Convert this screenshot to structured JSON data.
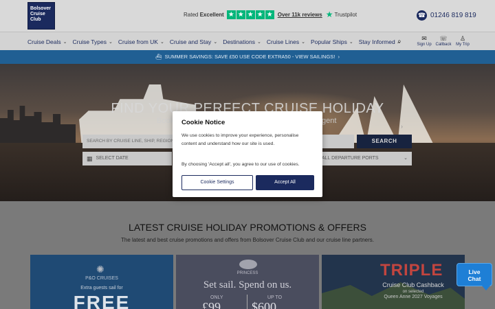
{
  "header": {
    "logo_text": "Bolsover Cruise Club",
    "rating_prefix": "Rated",
    "rating_word": "Excellent",
    "reviews_text": "Over 11k reviews",
    "trustpilot_label": "Trustpilot",
    "phone": "01246 819 819"
  },
  "nav": {
    "items": [
      {
        "label": "Cruise Deals"
      },
      {
        "label": "Cruise Types"
      },
      {
        "label": "Cruise from UK"
      },
      {
        "label": "Cruise and Stay"
      },
      {
        "label": "Destinations"
      },
      {
        "label": "Cruise Lines"
      },
      {
        "label": "Popular Ships"
      },
      {
        "label": "Stay Informed"
      }
    ],
    "icons": [
      {
        "label": "Sign Up",
        "icon": "envelope-icon"
      },
      {
        "label": "Callback",
        "icon": "chat-icon"
      },
      {
        "label": "My Trip",
        "icon": "user-icon"
      }
    ]
  },
  "promo_banner": "SUMMER SAVINGS: SAVE £50 USE CODE EXTRA50 - VIEW SAILINGS!",
  "hero": {
    "title": "FIND YOUR PERFECT CRUISE HOLIDAY",
    "subtitle_left": "Book",
    "subtitle_right": "gent",
    "search_placeholder": "SEARCH BY CRUISE LINE, SHIP, REGION",
    "search_button": "SEARCH",
    "date_placeholder": "SELECT DATE",
    "ports_placeholder": "ALL DEPARTURE PORTS"
  },
  "promotions": {
    "title": "LATEST CRUISE HOLIDAY PROMOTIONS & OFFERS",
    "subtitle": "The latest and best cruise promotions and offers from Bolsover Cruise Club and our cruise line partners.",
    "card1": {
      "brand": "P&O CRUISES",
      "line": "Extra guests sail for",
      "big": "FREE"
    },
    "card2": {
      "brand": "PRINCESS",
      "headline": "Set sail. Spend on us.",
      "only": "ONLY",
      "upto": "UP TO",
      "price1": "£99",
      "price2": "$600"
    },
    "card3": {
      "triple": "TRIPLE",
      "line2": "Cruise Club Cashback",
      "line3": "on selected",
      "line4": "Queen Anne 2027 Voyages"
    }
  },
  "cookie": {
    "title": "Cookie Notice",
    "text": "We use cookies to improve your experience, personalise content and understand how our site is used.",
    "text2": "By choosing 'Accept all', you agree to our use of cookies.",
    "settings_button": "Cookie Settings",
    "accept_button": "Accept All"
  },
  "chat": {
    "line1": "Live",
    "line2": "Chat"
  },
  "colors": {
    "brand_navy": "#1b2a5e",
    "promo_blue": "#205f93",
    "trustpilot_green": "#00b67a",
    "chat_blue": "#1e7fd6"
  }
}
